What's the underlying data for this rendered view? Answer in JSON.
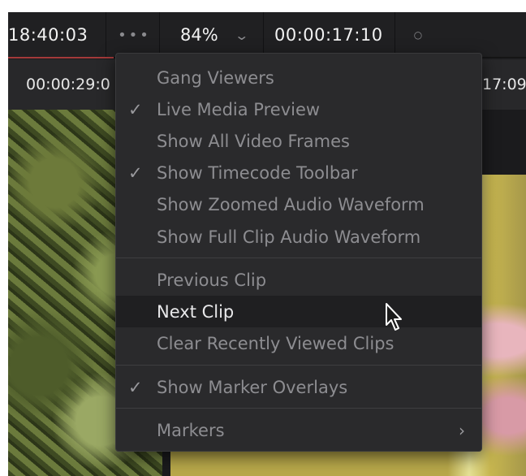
{
  "toolbar": {
    "timecode_left": "18:40:03",
    "more_glyph": "•••",
    "zoom_value": "84%",
    "zoom_chevron": "⌄",
    "timecode_right": "00:00:17:10",
    "dot_glyph": "○"
  },
  "subbar": {
    "timecode_left": "00:00:29:0",
    "timecode_right": "17:09"
  },
  "menu": {
    "items": [
      {
        "label": "Gang Viewers",
        "checked": false,
        "state": "dim"
      },
      {
        "label": "Live Media Preview",
        "checked": true,
        "state": "dim"
      },
      {
        "label": "Show All Video Frames",
        "checked": false,
        "state": "dim"
      },
      {
        "label": "Show Timecode Toolbar",
        "checked": true,
        "state": "dim"
      },
      {
        "label": "Show Zoomed Audio Waveform",
        "checked": false,
        "state": "dim"
      },
      {
        "label": "Show Full Clip Audio Waveform",
        "checked": false,
        "state": "dim"
      },
      {
        "label": "Previous Clip",
        "checked": false,
        "state": "dim"
      },
      {
        "label": "Next Clip",
        "checked": false,
        "state": "highlight"
      },
      {
        "label": "Clear Recently Viewed Clips",
        "checked": false,
        "state": "dim"
      },
      {
        "label": "Show Marker Overlays",
        "checked": true,
        "state": "dim"
      },
      {
        "label": "Markers",
        "checked": false,
        "state": "dim",
        "submenu": true
      }
    ],
    "check_glyph": "✓",
    "submenu_glyph": "›"
  },
  "colors": {
    "background": "#1b1b1d",
    "menu_bg": "#2a2a2c",
    "highlight_bg": "#1f1f21",
    "dim_text": "#8d8d91",
    "bright_text": "#e8e8ea",
    "accent_red": "#a33a3a"
  }
}
